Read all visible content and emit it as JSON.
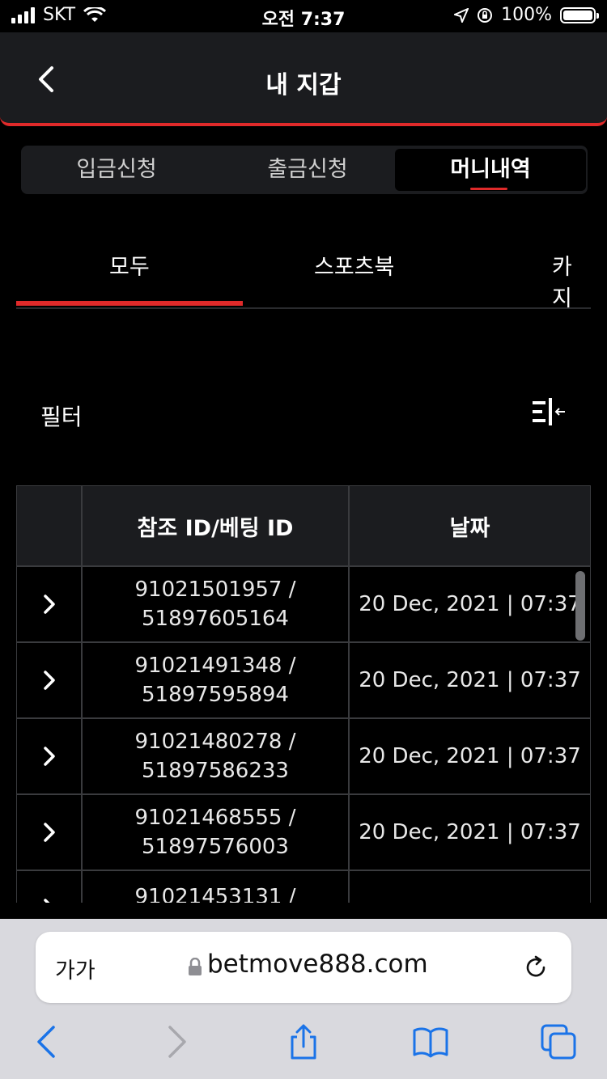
{
  "status_bar": {
    "carrier": "SKT",
    "time": "오전 7:37",
    "battery": "100%"
  },
  "header": {
    "title": "내 지갑"
  },
  "wallet_tabs": [
    "입금신청",
    "출금신청",
    "머니내역"
  ],
  "category_tabs": [
    "모두",
    "스포츠북",
    "카지"
  ],
  "filter": {
    "label": "필터"
  },
  "table": {
    "headers": [
      "참조 ID/베팅 ID",
      "날짜"
    ],
    "rows": [
      {
        "ref_id": "91021501957 /",
        "bet_id": "51897605164",
        "date": "20 Dec, 2021 | 07:37"
      },
      {
        "ref_id": "91021491348 /",
        "bet_id": "51897595894",
        "date": "20 Dec, 2021 | 07:37"
      },
      {
        "ref_id": "91021480278 /",
        "bet_id": "51897586233",
        "date": "20 Dec, 2021 | 07:37"
      },
      {
        "ref_id": "91021468555 /",
        "bet_id": "51897576003",
        "date": "20 Dec, 2021 | 07:37"
      },
      {
        "ref_id": "91021453131 /",
        "bet_id": "",
        "date": ""
      }
    ]
  },
  "browser": {
    "text_size_label": "가가",
    "url": "betmove888.com"
  },
  "colors": {
    "accent": "#e02a2a",
    "surface": "#1b1c1f",
    "ios_blue": "#1a73e8"
  }
}
